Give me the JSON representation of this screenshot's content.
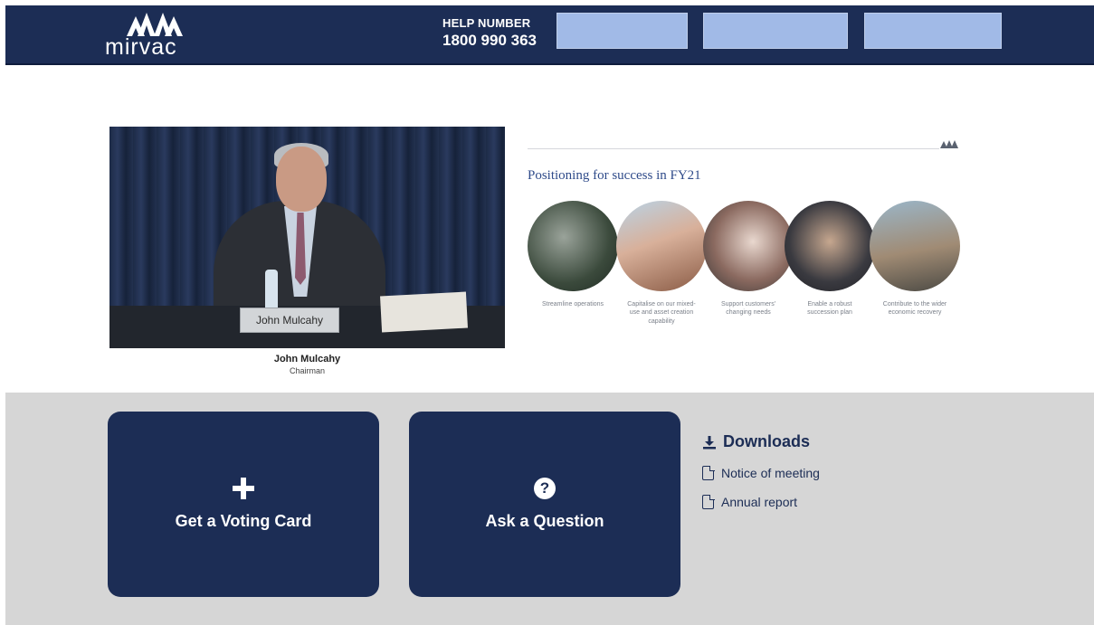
{
  "header": {
    "logo_text": "mirvac",
    "help_label": "HELP NUMBER",
    "help_number": "1800 990 363",
    "buttons": [
      {
        "label": ""
      },
      {
        "label": ""
      },
      {
        "label": ""
      }
    ]
  },
  "video": {
    "nameplate": "John Mulcahy",
    "speaker_name": "John Mulcahy",
    "speaker_role": "Chairman"
  },
  "slide": {
    "title": "Positioning for success in FY21",
    "pillars": [
      {
        "caption": "Streamline operations"
      },
      {
        "caption": "Capitalise on our mixed-use and asset creation capability"
      },
      {
        "caption": "Support customers' changing needs"
      },
      {
        "caption": "Enable a robust succession plan"
      },
      {
        "caption": "Contribute to the wider economic recovery"
      }
    ]
  },
  "actions": {
    "voting_card_label": "Get a Voting Card",
    "ask_question_label": "Ask a Question"
  },
  "downloads": {
    "title": "Downloads",
    "items": [
      {
        "label": "Notice of meeting"
      },
      {
        "label": "Annual report"
      }
    ]
  },
  "colors": {
    "brand_navy": "#1c2d55",
    "header_button": "#a9c2ef",
    "panel_grey": "#d6d6d6"
  }
}
